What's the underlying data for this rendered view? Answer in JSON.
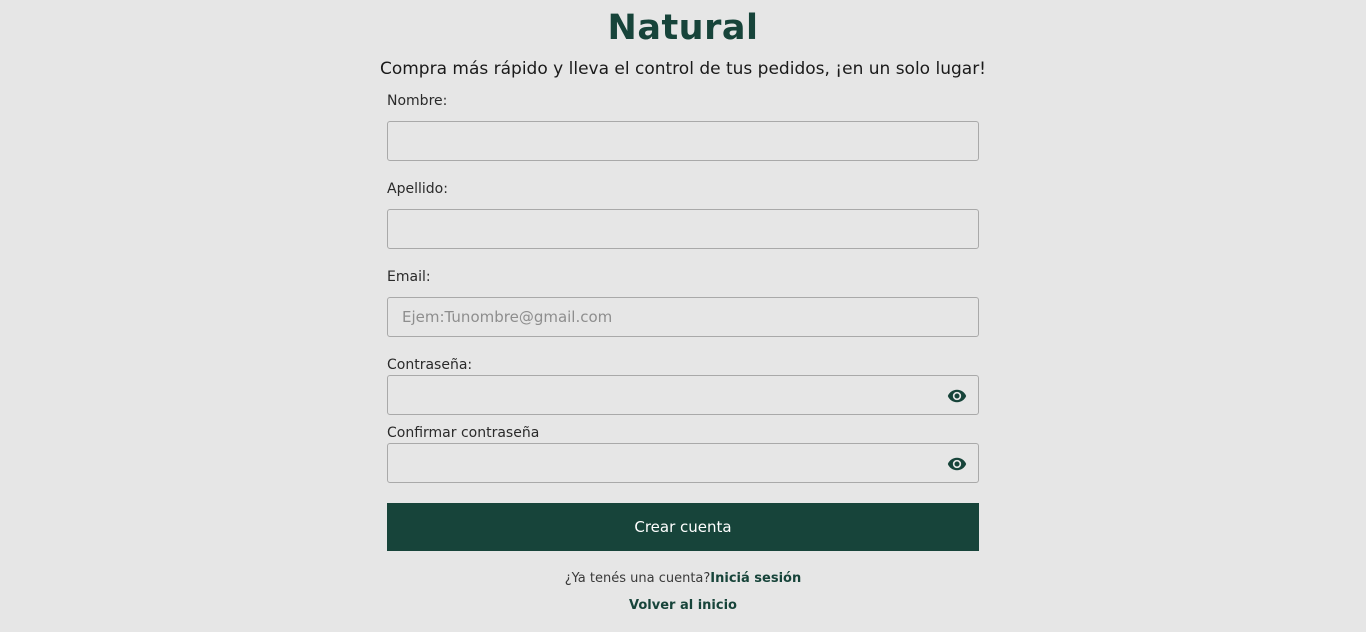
{
  "brand": {
    "logo_text": "Natural",
    "primary_color": "#17443a"
  },
  "tagline": "Compra más rápido y lleva el control de tus pedidos, ¡en un solo lugar!",
  "form": {
    "first_name": {
      "label": "Nombre:",
      "value": "",
      "placeholder": ""
    },
    "last_name": {
      "label": "Apellido:",
      "value": "",
      "placeholder": ""
    },
    "email": {
      "label": "Email:",
      "value": "",
      "placeholder": "Ejem:Tunombre@gmail.com"
    },
    "password": {
      "label": "Contraseña:",
      "value": "",
      "placeholder": "",
      "toggle_icon": "eye-icon"
    },
    "confirm_password": {
      "label": "Confirmar contraseña",
      "value": "",
      "placeholder": "",
      "toggle_icon": "eye-icon"
    },
    "submit_label": "Crear cuenta"
  },
  "footer": {
    "login_prompt": "¿Ya tenés una cuenta?",
    "login_link": "Iniciá sesión",
    "back_link": "Volver al inicio"
  }
}
